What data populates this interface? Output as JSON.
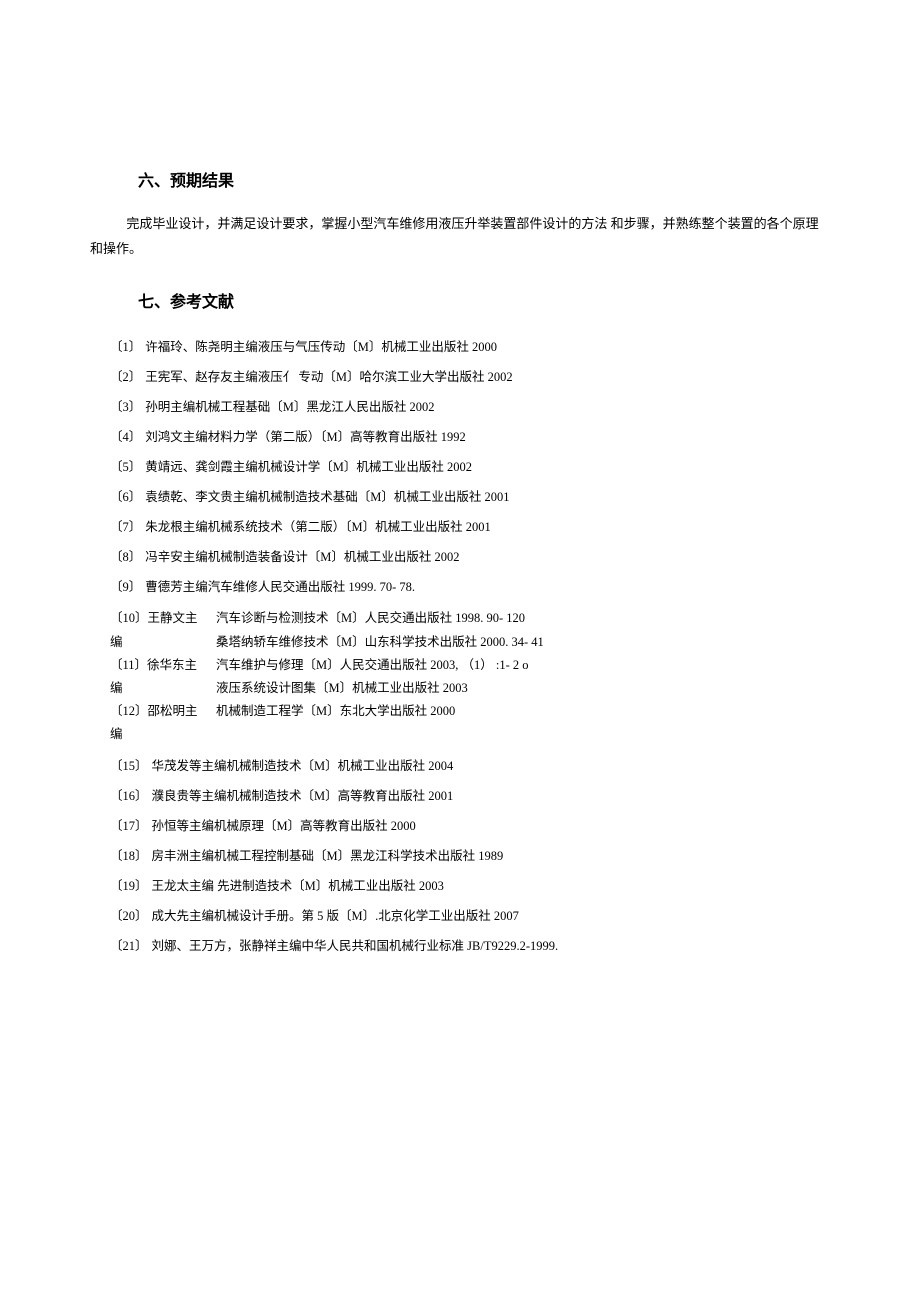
{
  "section6": {
    "heading": "六、预期结果",
    "paragraph": "完成毕业设计，并满足设计要求，掌握小型汽车维修用液压升举装置部件设计的方法 和步骤，并熟练整个装置的各个原理和操作。"
  },
  "section7": {
    "heading": "七、参考文献",
    "refs_simple": [
      {
        "num": "〔1〕",
        "text": "许福玲、陈尧明主编液压与气压传动〔M〕机械工业出版社 2000"
      },
      {
        "num": "〔2〕",
        "text": "王宪军、赵存友主编液压亻 专动〔M〕哈尔滨工业大学出版社 2002"
      },
      {
        "num": "〔3〕",
        "text": "孙明主编机械工程基础〔M〕黑龙江人民出版社  2002"
      },
      {
        "num": "〔4〕",
        "text": "刘鸿文主编材料力学（第二版）〔M〕高等教育出版社 1992"
      },
      {
        "num": "〔5〕",
        "text": "黄靖远、龚剑霞主编机械设计学〔M〕机械工业出版社 2002"
      },
      {
        "num": "〔6〕",
        "text": "袁绩乾、李文贵主编机械制造技术基础〔M〕机械工业出版社 2001"
      },
      {
        "num": "〔7〕",
        "text": "朱龙根主编机械系统技术（第二版）〔M〕机械工业出版社 2001"
      },
      {
        "num": "〔8〕",
        "text": "冯辛安主编机械制造装备设计〔M〕机械工业出版社 2002"
      },
      {
        "num": "〔9〕",
        "text": "曹德芳主编汽车维修人民交通出版社 1999. 70- 78."
      }
    ],
    "mixed": {
      "left_lines": [
        "〔10〕王静文主",
        "编",
        "〔11〕徐华东主",
        "编",
        "〔12〕邵松明主",
        "编"
      ],
      "right_lines": [
        "汽车诊断与检测技术〔M〕人民交通出版社 1998. 90- 120",
        "桑塔纳轿车维修技术〔M〕山东科学技术出版社  2000. 34- 41",
        "汽车维护与修理〔M〕人民交通出版社 2003, （1） :1- 2 o",
        "液压系统设计图集〔M〕机械工业出版社 2003",
        "机械制造工程学〔M〕东北大学出版社 2000"
      ]
    },
    "refs_tail": [
      {
        "num": "〔15〕",
        "text": "华茂发等主编机械制造技术〔M〕机械工业出版社 2004"
      },
      {
        "num": "〔16〕",
        "text": "濮良贵等主编机械制造技术〔M〕高等教育出版社 2001"
      },
      {
        "num": "〔17〕",
        "text": "孙恒等主编机械原理〔M〕高等教育出版社 2000"
      },
      {
        "num": "〔18〕",
        "text": "房丰洲主编机械工程控制基础〔M〕黑龙江科学技术出版社 1989"
      },
      {
        "num": "〔19〕",
        "text": "王龙太主编  先进制造技术〔M〕机械工业出版社 2003"
      },
      {
        "num": "〔20〕",
        "text": "成大先主编机械设计手册。第  5 版〔M〕.北京化学工业出版社  2007"
      },
      {
        "num": "〔21〕",
        "text": "刘娜、王万方，张静祥主编中华人民共和国机械行业标准 JB/T9229.2-1999."
      }
    ]
  }
}
